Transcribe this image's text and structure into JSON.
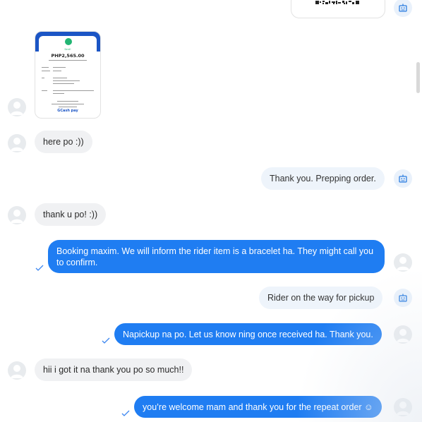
{
  "colors": {
    "outgoing_blue": "#1f7df2",
    "incoming_gray": "#f0f1f3",
    "page_reply_bg": "#eef4fb",
    "bot_icon": "#2b7de0"
  },
  "receipt": {
    "status": "Sent!",
    "amount": "PHP2,565.00",
    "brand": "GCash pay"
  },
  "messages": [
    {
      "text": "here po :))"
    },
    {
      "text": "Thank you. Prepping order."
    },
    {
      "text": "thank u po! :))"
    },
    {
      "text": "Booking maxim. We will inform the rider item is a bracelet ha. They might call you to confirm."
    },
    {
      "text": "Rider on the way for pickup"
    },
    {
      "text": "Napickup na po. Let us know ning once received ha. Thank you."
    },
    {
      "text": "hii i got it na thank you po so much!!"
    },
    {
      "text": "you’re welcome mam and thank you for the repeat order ☺"
    }
  ],
  "icons": {
    "avatar": "user-avatar-icon",
    "bot": "automated-reply-icon",
    "seen": "read-check-icon"
  }
}
